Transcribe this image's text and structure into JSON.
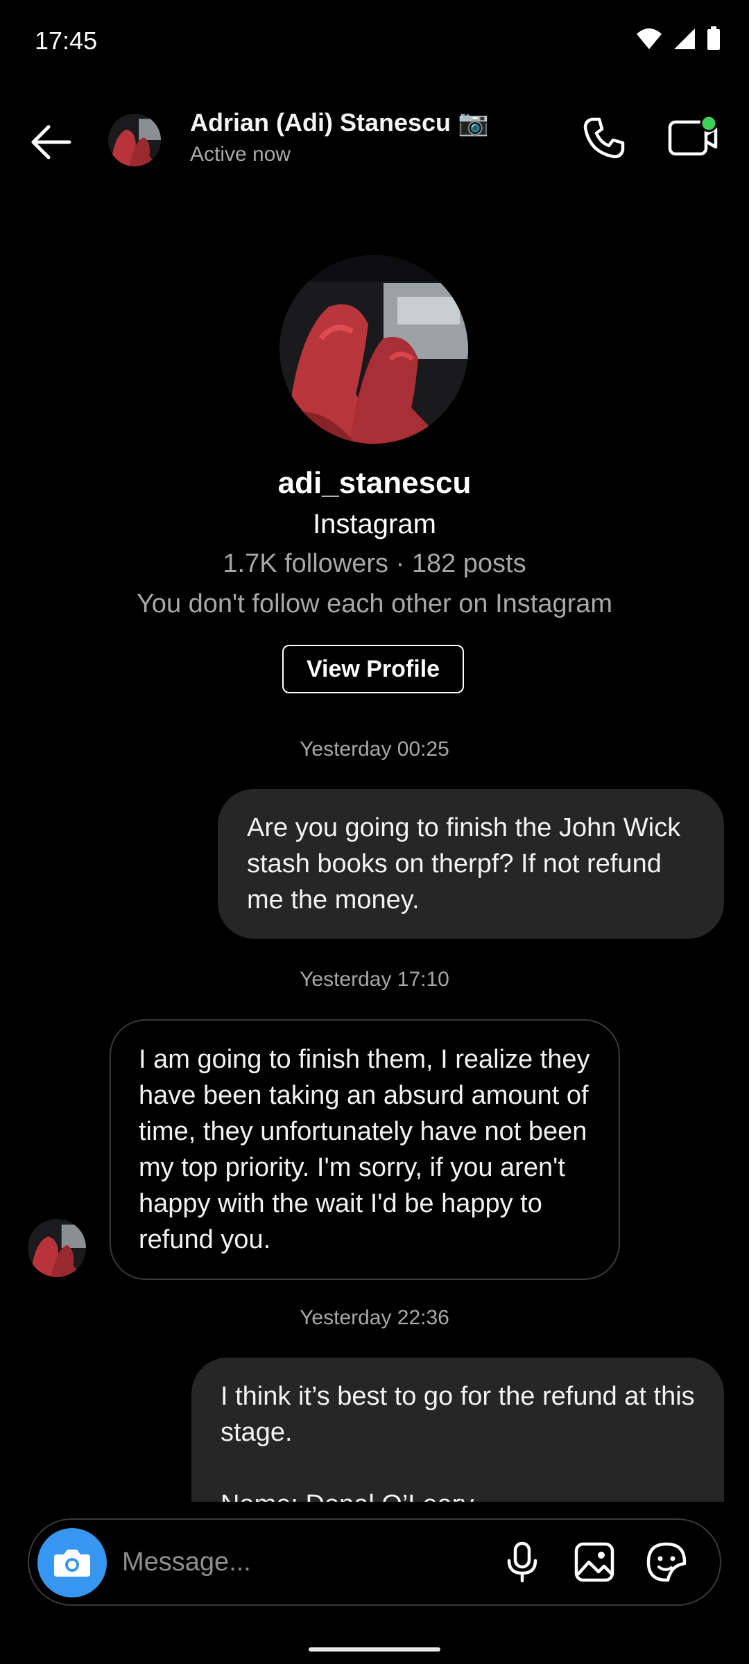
{
  "status_bar": {
    "time": "17:45"
  },
  "header": {
    "name": "Adrian (Adi) Stanescu 📷",
    "status": "Active now"
  },
  "profile": {
    "username": "adi_stanescu",
    "platform": "Instagram",
    "stats": "1.7K followers · 182 posts",
    "follow_note": "You don't follow each other on Instagram",
    "view_profile_label": "View Profile"
  },
  "messages": [
    {
      "timestamp": "Yesterday 00:25",
      "direction": "outgoing",
      "text": "Are you going to finish the John Wick stash books on therpf? If not refund me the money."
    },
    {
      "timestamp": "Yesterday 17:10",
      "direction": "incoming",
      "text": "I am going to finish them, I realize they have been taking an absurd amount of time, they unfortunately have not been my top priority. I'm sorry, if you aren't happy with the wait I'd be happy to refund you."
    },
    {
      "timestamp": "Yesterday 22:36",
      "direction": "outgoing",
      "text_line1": "I think it’s best to go for the refund at this stage.",
      "text_line2": "Name: Donal O’Leary"
    }
  ],
  "composer": {
    "placeholder": "Message..."
  },
  "colors": {
    "accent": "#3797f0",
    "online": "#3ecf5a",
    "bubble_out": "#262626"
  }
}
